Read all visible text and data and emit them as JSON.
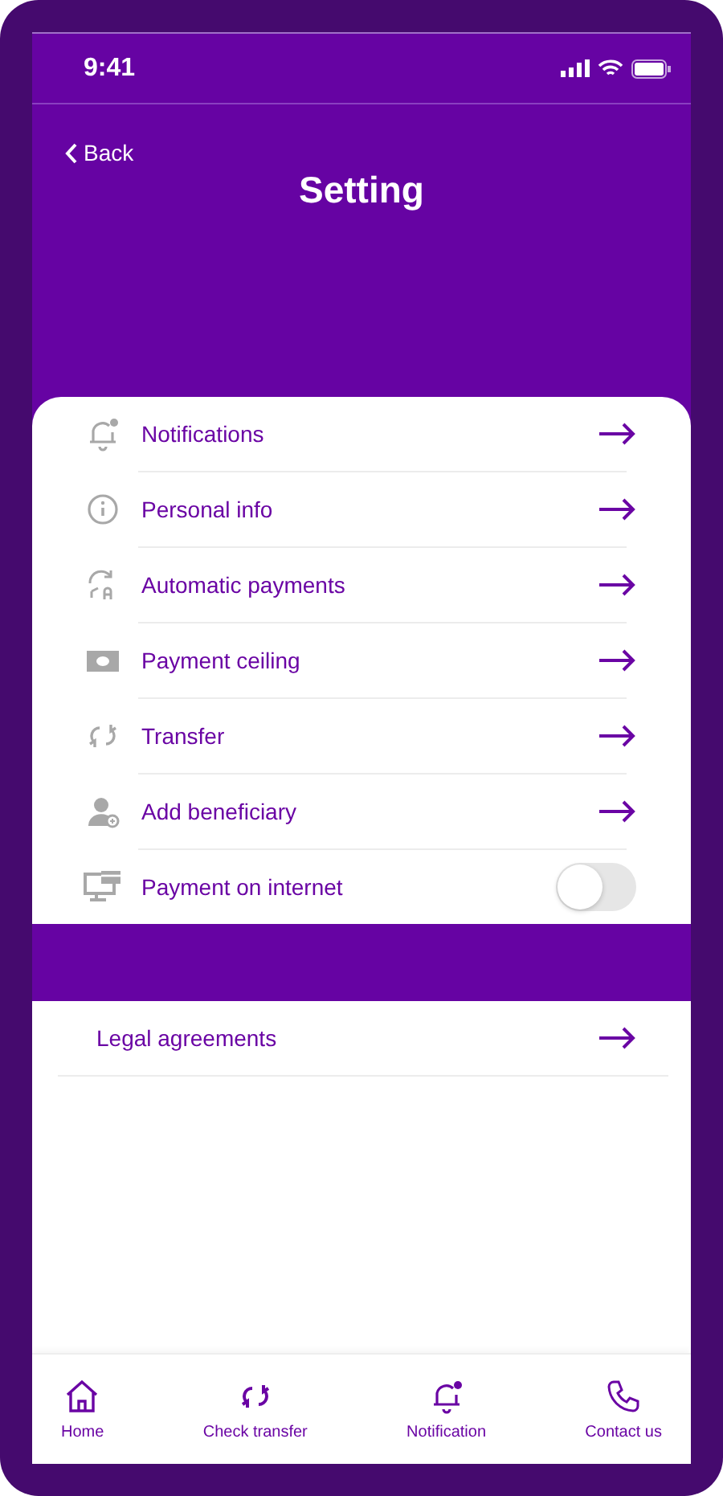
{
  "status_bar": {
    "time": "9:41"
  },
  "header": {
    "back": "Back",
    "title": "Setting"
  },
  "settings": [
    {
      "label": "Notifications",
      "kind": "link"
    },
    {
      "label": "Personal info",
      "kind": "link"
    },
    {
      "label": "Automatic payments",
      "kind": "link"
    },
    {
      "label": "Payment ceiling",
      "kind": "link"
    },
    {
      "label": "Transfer",
      "kind": "link"
    },
    {
      "label": "Add beneficiary",
      "kind": "link"
    },
    {
      "label": "Payment on internet",
      "kind": "toggle",
      "on": false
    }
  ],
  "other": [
    {
      "label": "Legal agreements",
      "kind": "link"
    }
  ],
  "tab_bar": [
    {
      "label": "Home"
    },
    {
      "label": "Check transfer"
    },
    {
      "label": "Notification"
    },
    {
      "label": "Contact us"
    }
  ]
}
